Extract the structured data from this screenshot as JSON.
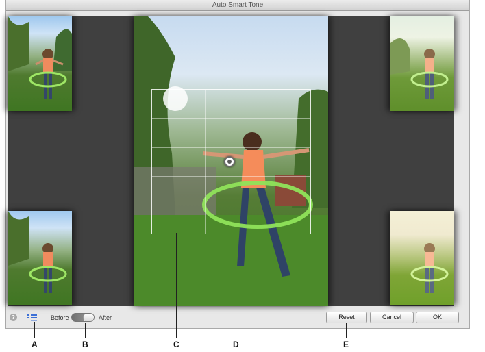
{
  "window": {
    "title": "Auto Smart Tone"
  },
  "footer": {
    "help_icon_glyph": "?",
    "toggle_before": "Before",
    "toggle_after": "After",
    "buttons": {
      "reset": "Reset",
      "cancel": "Cancel",
      "ok": "OK"
    }
  },
  "icons": [
    "help-icon",
    "show-corner-previews-icon",
    "control-point-icon"
  ],
  "callouts": [
    "A",
    "B",
    "C",
    "D",
    "E"
  ],
  "colors": {
    "canvas": "#404040",
    "window": "#e8e8e8",
    "hoop": "#8fe35a"
  }
}
